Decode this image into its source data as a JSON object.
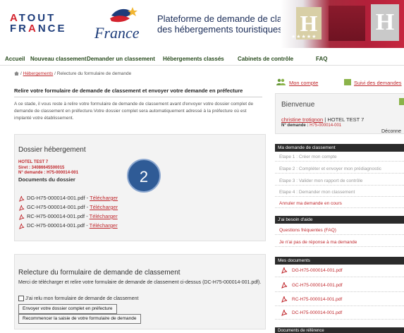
{
  "header": {
    "logo_line1": "ATOUT",
    "logo_line2": "FRANCE",
    "france_script": "France",
    "title_line1": "Plateforme de demande de classement",
    "title_line2": "des hébergements touristiques",
    "banner_letter": "H",
    "banner_stars": "★★★★★"
  },
  "nav": {
    "items": [
      "Accueil",
      "Nouveau classement",
      "Demander un classement",
      "Hébergements classés",
      "Cabinets de contrôle",
      "FAQ"
    ]
  },
  "breadcrumb": {
    "link": "Hébergements",
    "current": "/ Relecture du formulaire de demande"
  },
  "page": {
    "title": "Relire votre formulaire de demande de classement et envoyer votre demande en préfecture",
    "intro": "A ce stade, il vous reste à relire votre formulaire de demande de classement avant d'envoyer votre dossier complet de demande de classement en préfecture.Votre dossier complet sera automatiquement adressé à la préfecture où est implanté votre établissement."
  },
  "dossier": {
    "title": "Dossier hébergement",
    "hotel_name": "HOTEL TEST 7",
    "siret": "Siret : 34086645500015",
    "request_number": "N° demande : H75-000014-001",
    "docs_title": "Documents du dossier",
    "docs": [
      {
        "file": "DG-H75-000014-001.pdf",
        "link": "Télécharger"
      },
      {
        "file": "GC-H75-000014-001.pdf",
        "link": "Télécharger"
      },
      {
        "file": "RC-H75-000014-001.pdf",
        "link": "Télécharger"
      },
      {
        "file": "DC-H75-000014-001.pdf",
        "link": "Télécharger"
      }
    ],
    "separator": " - "
  },
  "step_badge": "2",
  "relecture": {
    "title": "Relecture du formulaire de demande de classement",
    "text": "Merci de télécharger et relire votre formulaire de demande de classement ci-dessus (DC-H75-000014-001.pdf).",
    "checkbox_label": "J'ai relu mon formulaire de demande de classement",
    "send_button": "Envoyer votre dossier complet en préfecture",
    "restart_button": "Recommencer la saisie de votre formulaire de demande"
  },
  "sidebar": {
    "account_link": "Mon compte",
    "requests_link": "Suivi des demandes",
    "welcome": "Bienvenue",
    "user": "christine trotignon",
    "user_sep": " | ",
    "hotel": "HOTEL TEST 7",
    "request_label": "N° demande : ",
    "request_number": "H75-000014-001",
    "logout": "Déconne",
    "classement_head": "Ma demande de classement",
    "steps": [
      "Etape 1 : Créer mon compte",
      "Etape 2 : Compléter et envoyer mon prédiagnostic",
      "Etape 3 : Valider mon rapport de contrôle",
      "Etape 4 : Demander mon classement"
    ],
    "cancel": "Annuler ma demande en cours",
    "help_head": "J'ai besoin d'aide",
    "help_items": [
      "Questions fréquentes (FAQ)",
      "Je n'ai pas de réponse à ma demande"
    ],
    "docs_head": "Mes documents",
    "my_docs": [
      "DG-H75-000014-001.pdf",
      "GC-H75-000014-001.pdf",
      "RC-H75-000014-001.pdf",
      "DC-H75-000014-001.pdf"
    ],
    "ref_head": "Documents de référence"
  },
  "colors": {
    "link_red": "#c0282d",
    "nav_green": "#2a4d1f",
    "panel_dark": "#2b2b2b",
    "badge_blue": "#2f5b96"
  }
}
